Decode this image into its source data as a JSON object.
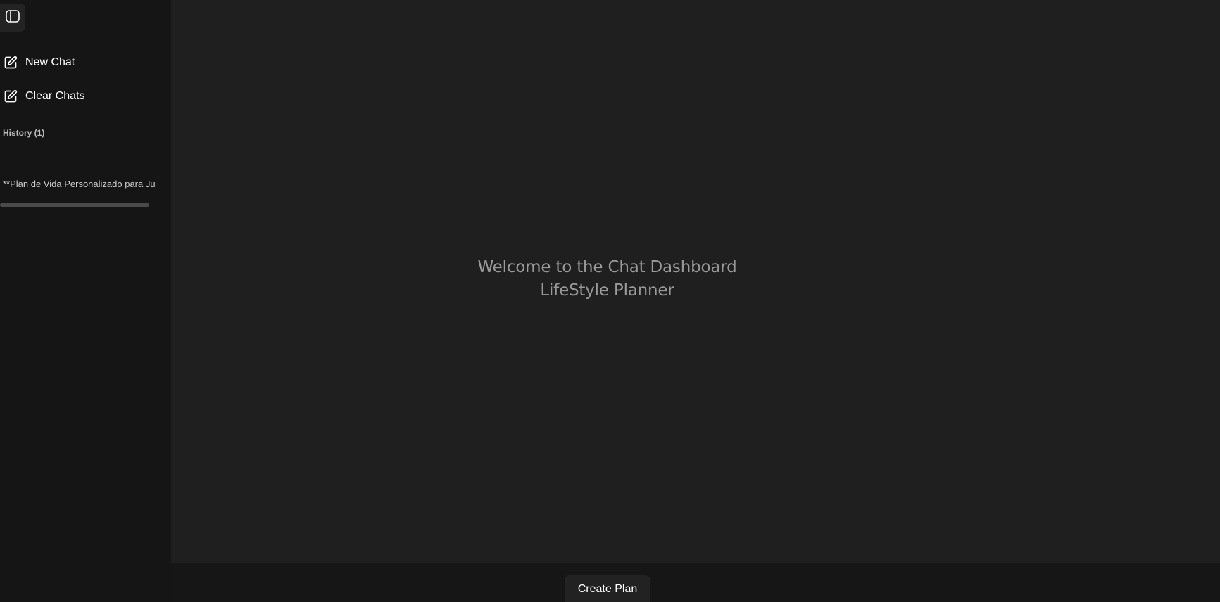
{
  "sidebar": {
    "toggle_icon": "sidebar-toggle-icon",
    "actions": [
      {
        "label": "New Chat",
        "icon": "edit-icon"
      },
      {
        "label": "Clear Chats",
        "icon": "edit-icon"
      }
    ],
    "history_title": "History (1)",
    "history_items": [
      {
        "title": "**Plan de Vida Personalizado para Ju"
      }
    ]
  },
  "main": {
    "welcome_line1": "Welcome to the Chat Dashboard",
    "welcome_line2": "LifeStyle Planner"
  },
  "footer": {
    "create_plan_label": "Create Plan"
  },
  "colors": {
    "sidebar_bg": "#151515",
    "main_bg": "#1f1f1f",
    "text_primary": "#ffffff",
    "text_muted": "#9a9a9a"
  }
}
